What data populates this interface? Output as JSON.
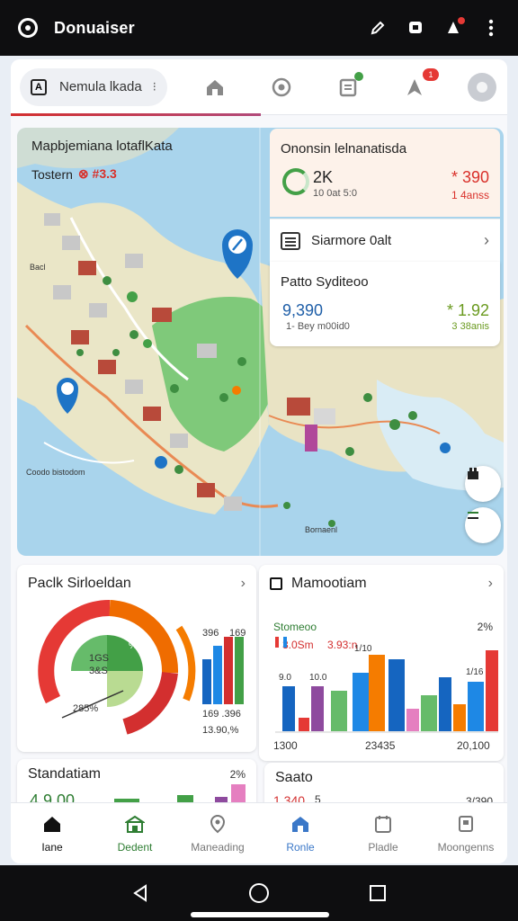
{
  "status_bar": {
    "title": "Donuaiser",
    "icons": [
      "logo-icon",
      "pencil-icon",
      "chat-icon",
      "alert-icon",
      "more-vert-icon"
    ]
  },
  "topbar": {
    "search_text": "Nemula lkada",
    "icons": [
      "home-icon",
      "target-icon",
      "clipboard-icon",
      "navigation-icon",
      "avatar-icon"
    ],
    "notification_count": "1"
  },
  "map": {
    "title": "Mapbjemiana lotaflKata",
    "subtitle": "Tostern",
    "subtitle_value": "⊗ #3.3",
    "labels": [
      "Bacl",
      "Coodo bistodom",
      "Bornaenl"
    ]
  },
  "stats": {
    "card1": {
      "header": "Ononsin lelnanatisda",
      "value": "2K",
      "sub": "10 0at 5:0",
      "right_value": "* 390",
      "right_sub": "1 4anss"
    },
    "row_link": {
      "label": "Siarmore 0alt"
    },
    "card2": {
      "header": "Patto Syditeoo",
      "value": "9,390",
      "sub": "1- Bey m00id0",
      "right_value": "* 1.92",
      "right_sub": "3 38anis"
    }
  },
  "panels": {
    "gauge": {
      "title": "Paclk Sirloeldan",
      "inner_label_1": "1GS",
      "inner_label_2": "3&S",
      "ring_label": "% b",
      "pct_label": "285%",
      "bars_top_1": "396",
      "bars_top_2": "169",
      "bars_bottom_1": "169 .396",
      "bars_bottom_2": "13.90,%"
    },
    "bar_chart": {
      "title": "Mamootiam",
      "legend_title": "Stomeoo",
      "legend_pct": "2%",
      "legend_sub_1": "3.0Sm",
      "legend_sub_2": "3.93:n",
      "top_labels": [
        "9.0",
        "10.0",
        "1/10",
        "1/16"
      ],
      "x_labels": [
        "1300",
        "23435",
        "20,100"
      ]
    },
    "bottom_left": {
      "title": "Standatiam",
      "pct": "2%",
      "value": "4.9.00"
    },
    "bottom_right": {
      "title": "Saato",
      "value": "1.340",
      "value_suffix": "5",
      "right": "3/390"
    }
  },
  "nav": {
    "items": [
      {
        "label": "Iane",
        "active": true
      },
      {
        "label": "Dedent",
        "active": false
      },
      {
        "label": "Maneading",
        "active": false
      },
      {
        "label": "Ronle",
        "active": false
      },
      {
        "label": "Pladle",
        "active": false
      },
      {
        "label": "Moongenns",
        "active": false
      }
    ]
  },
  "colors": {
    "accent_red": "#d9302a",
    "accent_green": "#43a047",
    "accent_blue": "#1f5fa8",
    "accent_orange": "#f57c00"
  }
}
